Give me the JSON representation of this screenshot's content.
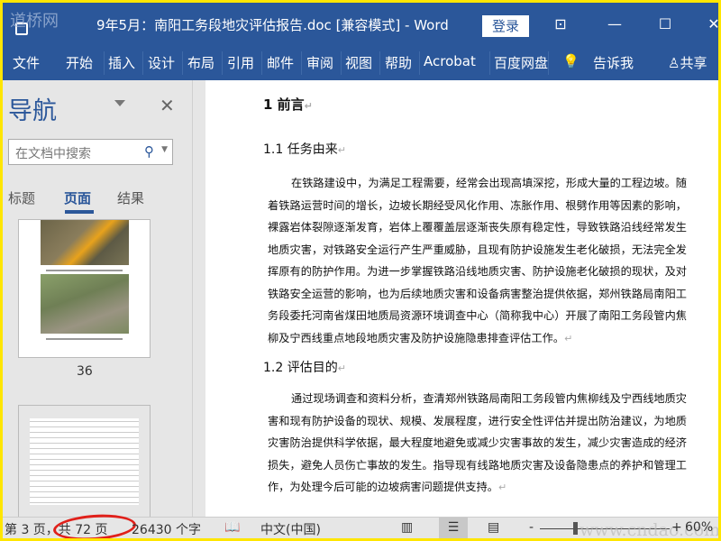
{
  "window": {
    "watermark_logo": "道桥网",
    "title": "9年5月：南阳工务段地灾评估报告.doc [兼容模式]  -  Word",
    "login": "登录",
    "ribbon_display": "⊡",
    "minimize": "—",
    "maximize": "☐",
    "close": "✕"
  },
  "ribbon": {
    "tabs": [
      "文件",
      "开始",
      "插入",
      "设计",
      "布局",
      "引用",
      "邮件",
      "审阅",
      "视图",
      "帮助",
      "Acrobat",
      "百度网盘"
    ],
    "tell_me": "告诉我",
    "share": "共享"
  },
  "nav": {
    "title": "导航",
    "search_placeholder": "在文档中搜索",
    "tabs": [
      "标题",
      "页面",
      "结果"
    ],
    "active_tab": "页面",
    "page_label": "36"
  },
  "doc": {
    "h1": "1  前言",
    "h2a": "1.1  任务由来",
    "p1": "在铁路建设中，为满足工程需要，经常会出现高填深挖，形成大量的工程边坡。随着铁路运营时间的增长，边坡长期经受风化作用、冻胀作用、根劈作用等因素的影响，裸露岩体裂隙逐渐发育，岩体上覆覆盖层逐渐丧失原有稳定性，导致铁路沿线经常发生地质灾害，对铁路安全运行产生严重威胁，且现有防护设施发生老化破损，无法完全发挥原有的防护作用。为进一步掌握铁路沿线地质灾害、防护设施老化破损的现状，及对铁路安全运营的影响，也为后续地质灾害和设备病害整治提供依据，郑州铁路局南阳工务段委托河南省煤田地质局资源环境调查中心（简称我中心）开展了南阳工务段管内焦柳及宁西线重点地段地质灾害及防护设施隐患排查评估工作。",
    "h2b": "1.2 评估目的",
    "p2": "通过现场调查和资料分析，查清郑州铁路局南阳工务段管内焦柳线及宁西线地质灾害和现有防护设备的现状、规模、发展程度，进行安全性评估并提出防治建议，为地质灾害防治提供科学依据，最大程度地避免或减少灾害事故的发生，减少灾害造成的经济损失，避免人员伤亡事故的发生。指导现有线路地质灾害及设备隐患点的养护和管理工作，为处理今后可能的边坡病害问题提供支持。",
    "para_mark": "↵"
  },
  "status": {
    "page": "第 3 页，共 72 页",
    "words": "26430 个字",
    "language": "中文(中国)",
    "zoom_minus": "-",
    "zoom_plus": "+",
    "zoom": "60%",
    "watermark": "www.cndao.com"
  },
  "colors": {
    "brand": "#2b579a",
    "annotation": "#e0201a",
    "frame": "#ffe600"
  }
}
